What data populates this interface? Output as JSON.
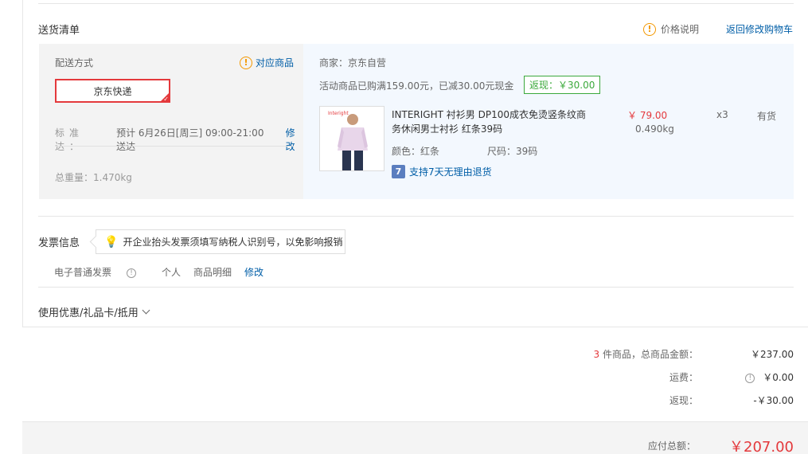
{
  "delivery": {
    "section_title": "送货清单",
    "price_note": "价格说明",
    "back_to_cart": "返回修改购物车",
    "shipping_method_label": "配送方式",
    "matching_items": "对应商品",
    "shipping_option": "京东快递",
    "eta_label": "标准达：",
    "eta_value": "预计 6月26日[周三] 09:00-21:00 送达",
    "eta_edit": "修改",
    "total_weight": "总重量：1.470kg"
  },
  "merchant": {
    "name": "商家：京东自营",
    "promo": "活动商品已购满159.00元，已减30.00元现金",
    "rebate": "返现：￥30.00"
  },
  "product": {
    "name": "INTERIGHT 衬衫男 DP100成衣免烫竖条纹商务休闲男士衬衫 红条39码",
    "price": "￥ 79.00",
    "weight": "0.490kg",
    "qty": "x3",
    "stock": "有货",
    "color": "颜色：红条",
    "size": "尺码：39码",
    "return_policy": "支持7天无理由退货",
    "thumb_brand": "Interight"
  },
  "invoice": {
    "title": "发票信息",
    "tip": "开企业抬头发票须填写纳税人识别号，以免影响报销",
    "type": "电子普通发票",
    "holder": "个人",
    "content": "商品明细",
    "edit": "修改"
  },
  "coupon": {
    "label": "使用优惠/礼品卡/抵用"
  },
  "summary": {
    "count": "3",
    "count_label": " 件商品，总商品金额：",
    "goods_total": "￥237.00",
    "freight_label": "运费：",
    "freight": "￥0.00",
    "rebate_label": "返现：",
    "rebate": "-￥30.00",
    "payable_label": "应付总额：",
    "payable": "￥207.00"
  },
  "colors": {
    "accent": "#e4393c",
    "link": "#005ea7",
    "warn": "#f39800",
    "green": "#3ba93b"
  },
  "icons": [
    "warning-icon",
    "info-icon",
    "lightbulb-icon",
    "return-7day-icon",
    "chevron-down-icon",
    "check-icon"
  ]
}
